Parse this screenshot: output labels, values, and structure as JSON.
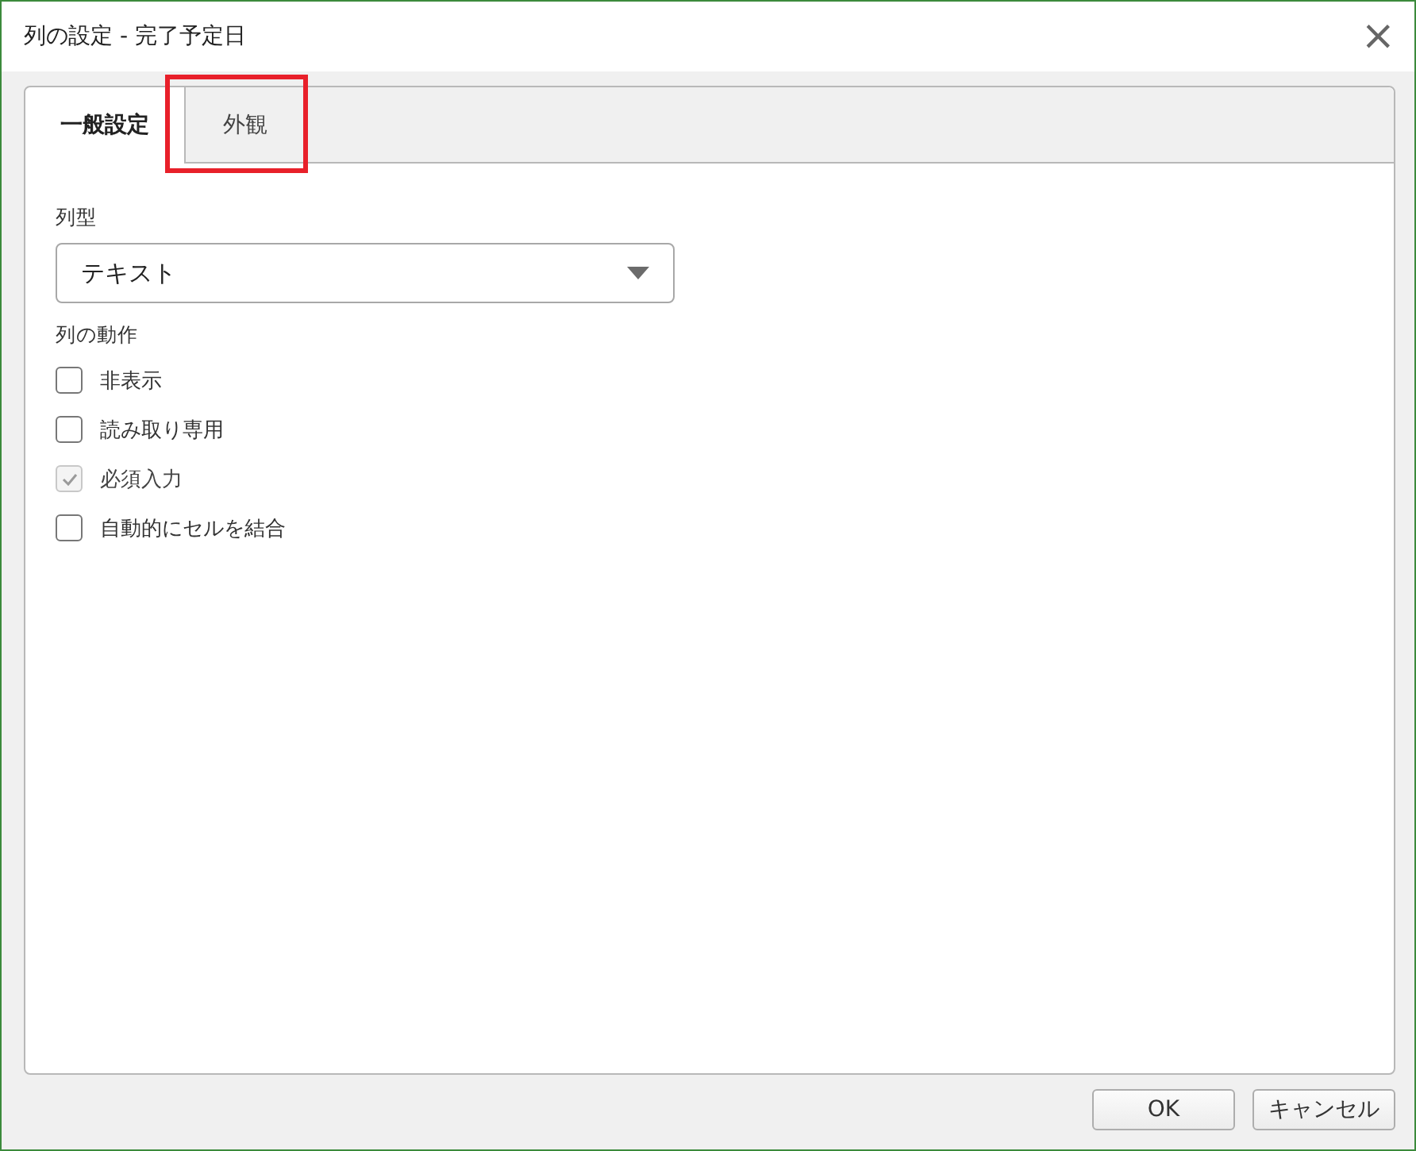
{
  "window": {
    "title": "列の設定 - 完了予定日",
    "close": "×"
  },
  "tabs": [
    {
      "label": "一般設定",
      "selected": true,
      "highlighted": false
    },
    {
      "label": "外観",
      "selected": false,
      "highlighted": true
    }
  ],
  "column_type": {
    "label": "列型",
    "value": "テキスト"
  },
  "behavior": {
    "label": "列の動作",
    "options": [
      {
        "label": "非表示",
        "checked": false,
        "disabled": false
      },
      {
        "label": "読み取り専用",
        "checked": false,
        "disabled": false
      },
      {
        "label": "必須入力",
        "checked": true,
        "disabled": true
      },
      {
        "label": "自動的にセルを結合",
        "checked": false,
        "disabled": false
      }
    ]
  },
  "buttons": [
    "OK",
    "キャンセル"
  ]
}
